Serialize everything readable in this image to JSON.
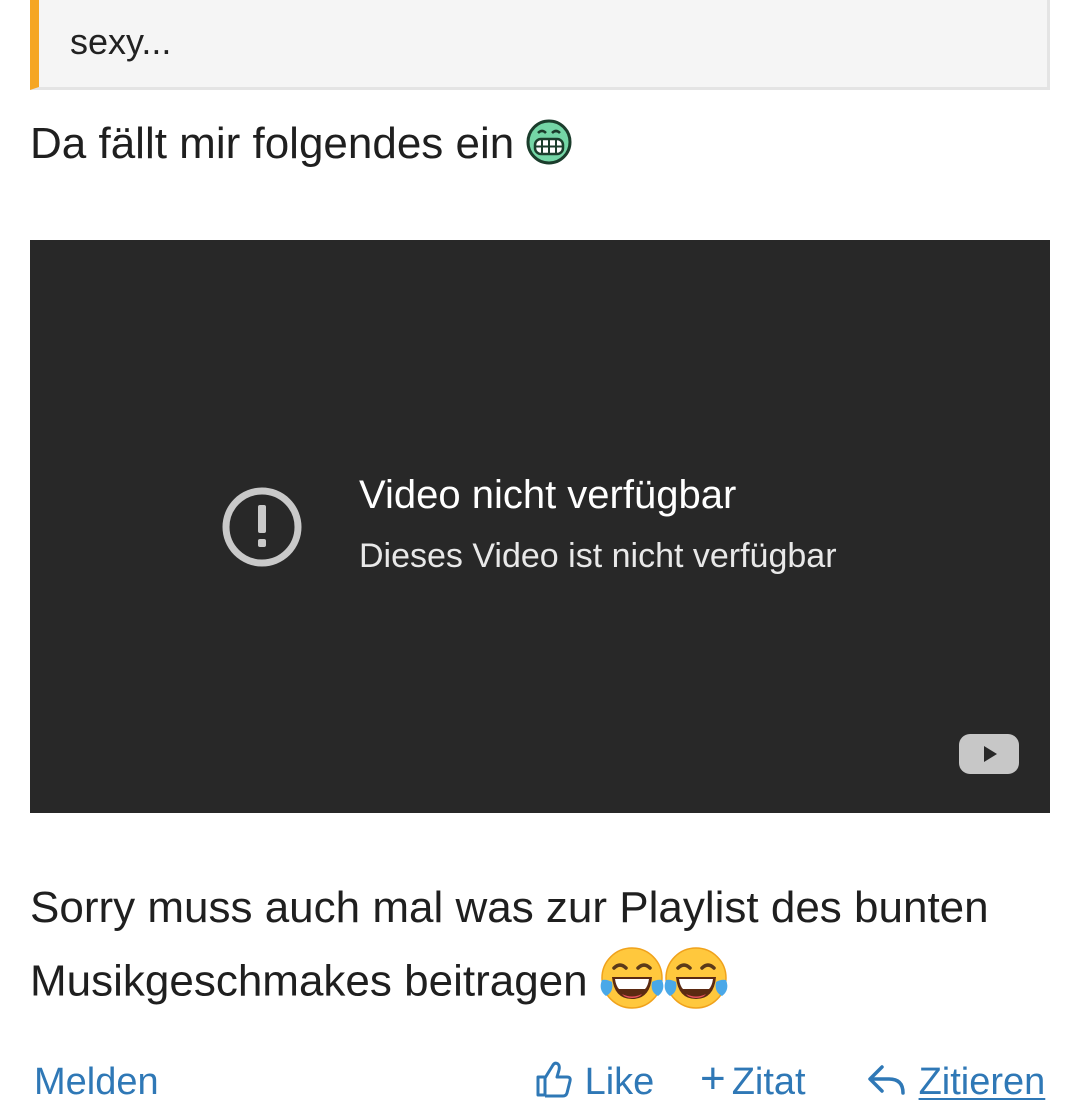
{
  "quote": {
    "text": "sexy...",
    "accent_color": "#f5a623"
  },
  "post": {
    "line1": "Da fällt mir folgendes ein",
    "line1_emoji": "grinning-teeth-icon",
    "line2": "Sorry muss auch mal was zur Playlist des bunten",
    "line3": "Musikgeschmakes beitragen",
    "line3_emojis": [
      "laughing-tears-icon",
      "laughing-tears-icon"
    ]
  },
  "video": {
    "title": "Video nicht verfügbar",
    "subtitle": "Dieses Video ist nicht verfügbar",
    "icons": [
      "warning-icon",
      "youtube-icon"
    ],
    "background": "#282828"
  },
  "actions": {
    "report": "Melden",
    "like": "Like",
    "quote_add": "Zitat",
    "quote_reply": "Zitieren",
    "link_color": "#2f78b6"
  }
}
